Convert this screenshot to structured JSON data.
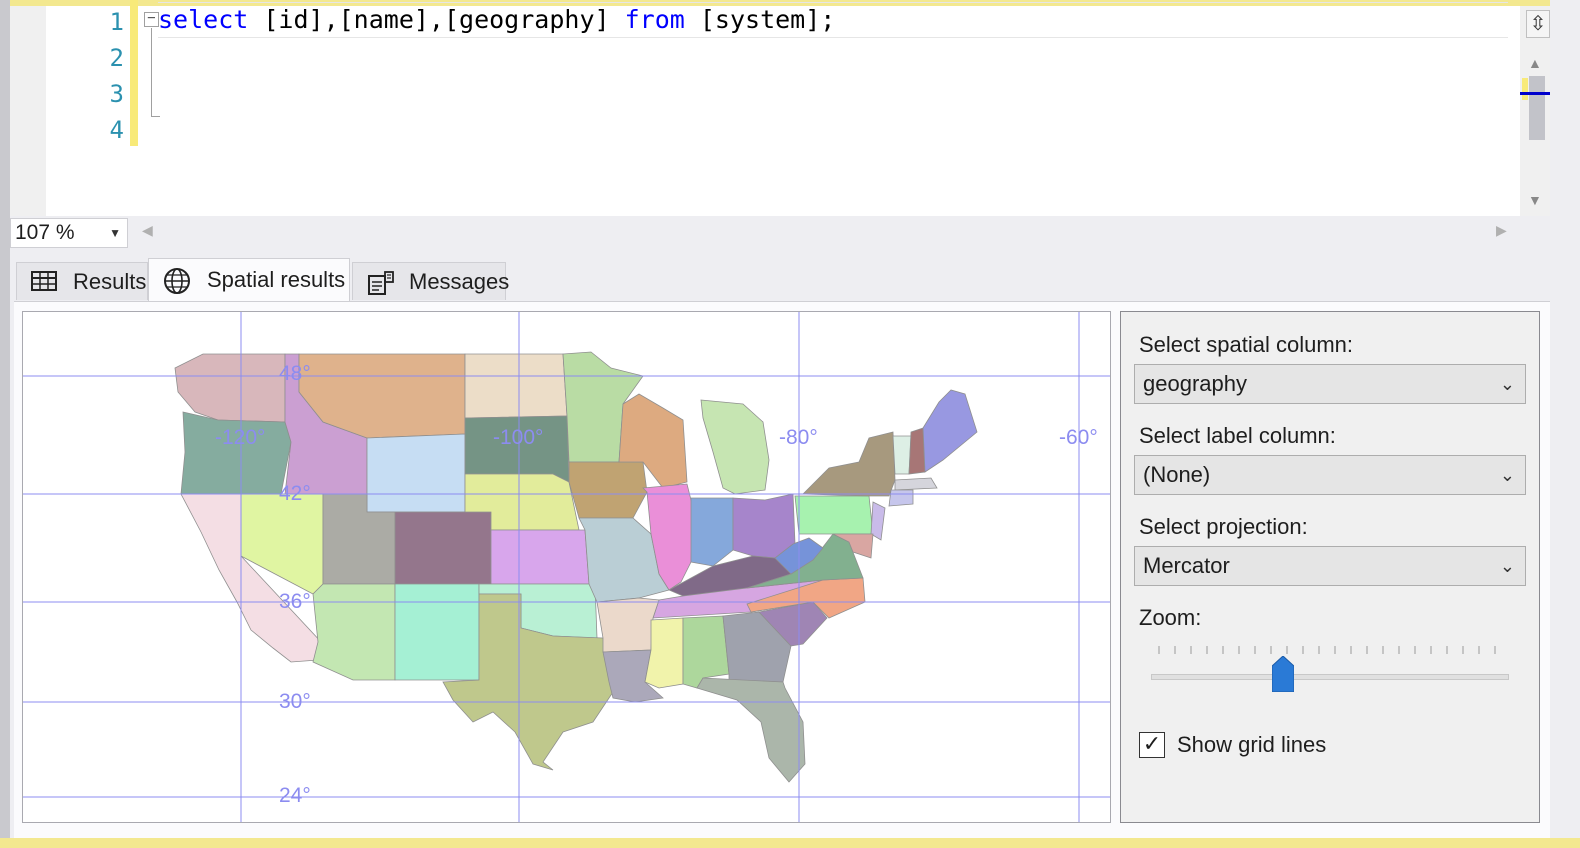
{
  "editor": {
    "line_numbers": [
      "1",
      "2",
      "3",
      "4"
    ],
    "line1": {
      "kw_select": "select",
      "cols": " [id],[name],[geography] ",
      "kw_from": "from",
      "table": " [system];"
    },
    "collapse_glyph": "−"
  },
  "status": {
    "zoom": "107 %"
  },
  "tabs": {
    "results": "Results",
    "spatial": "Spatial results",
    "messages": "Messages"
  },
  "icons": {
    "results": "table-grid-icon",
    "spatial": "globe-icon",
    "messages": "messages-icon",
    "split": "splitter-icon"
  },
  "map": {
    "lon_labels": [
      "-120°",
      "-100°",
      "-80°",
      "-60°"
    ],
    "lat_labels": [
      "48°",
      "42°",
      "36°",
      "30°",
      "24°"
    ],
    "grid_color": "#8c8cf0"
  },
  "controls": {
    "spatial_column_label": "Select spatial column:",
    "spatial_column_value": "geography",
    "label_column_label": "Select label column:",
    "label_column_value": "(None)",
    "projection_label": "Select projection:",
    "projection_value": "Mercator",
    "zoom_label": "Zoom:",
    "zoom_level": 0.37,
    "grid_lines_label": "Show grid lines",
    "grid_lines_checked": true
  },
  "colors": {
    "keyword": "#0000ff",
    "line_number": "#2b91af",
    "slider_thumb": "#2a7ad6"
  }
}
